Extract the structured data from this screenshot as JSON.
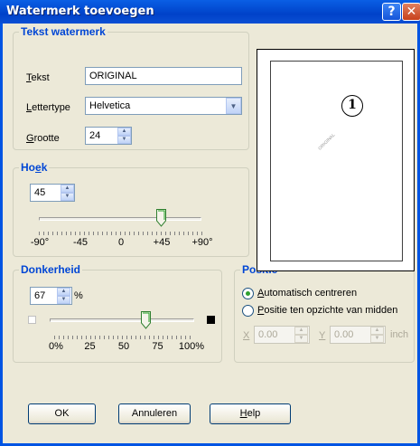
{
  "window": {
    "title": "Watermerk toevoegen",
    "help_glyph": "?",
    "close_glyph": "✕"
  },
  "text_group": {
    "legend": "Tekst watermerk",
    "text_label_first": "T",
    "text_label_rest": "ekst",
    "text_value": "ORIGINAL",
    "font_label_first": "L",
    "font_label_rest": "ettertype",
    "font_value": "Helvetica",
    "size_label_first": "G",
    "size_label_rest": "rootte",
    "size_value": "24"
  },
  "angle_group": {
    "legend_start": "Ho",
    "legend_underline": "e",
    "legend_end": "k",
    "value": "45",
    "slider_value": 45,
    "slider_range": [
      -90,
      90
    ],
    "ticks": [
      "-90°",
      "-45",
      "0",
      "+45",
      "+90°"
    ]
  },
  "darkness_group": {
    "legend": "Donkerheid",
    "value": "67",
    "unit": "%",
    "slider_value": 67,
    "ticks": [
      "0%",
      "25",
      "50",
      "75",
      "100%"
    ]
  },
  "position_group": {
    "legend": "Positie",
    "option_auto_first": "A",
    "option_auto_rest": "utomatisch centreren",
    "option_auto_selected": true,
    "option_relative_first": "P",
    "option_relative_rest": "ositie ten opzichte van midden",
    "x_label": "X",
    "x_value": "0.00",
    "y_label": "Y",
    "y_value": "0.00",
    "unit": "inch"
  },
  "preview": {
    "badge": "1",
    "watermark_text": "ORIGINAL"
  },
  "buttons": {
    "ok": "OK",
    "cancel": "Annuleren",
    "help_first": "H",
    "help_rest": "elp"
  },
  "icons": {
    "spin_up": "▲",
    "spin_down": "▼",
    "dropdown": "▼",
    "white_square": "white-square-icon",
    "black_square": "black-square-icon"
  },
  "colors": {
    "title_bar": "#0054e3",
    "legend": "#0046d5",
    "close": "#c8401c"
  }
}
